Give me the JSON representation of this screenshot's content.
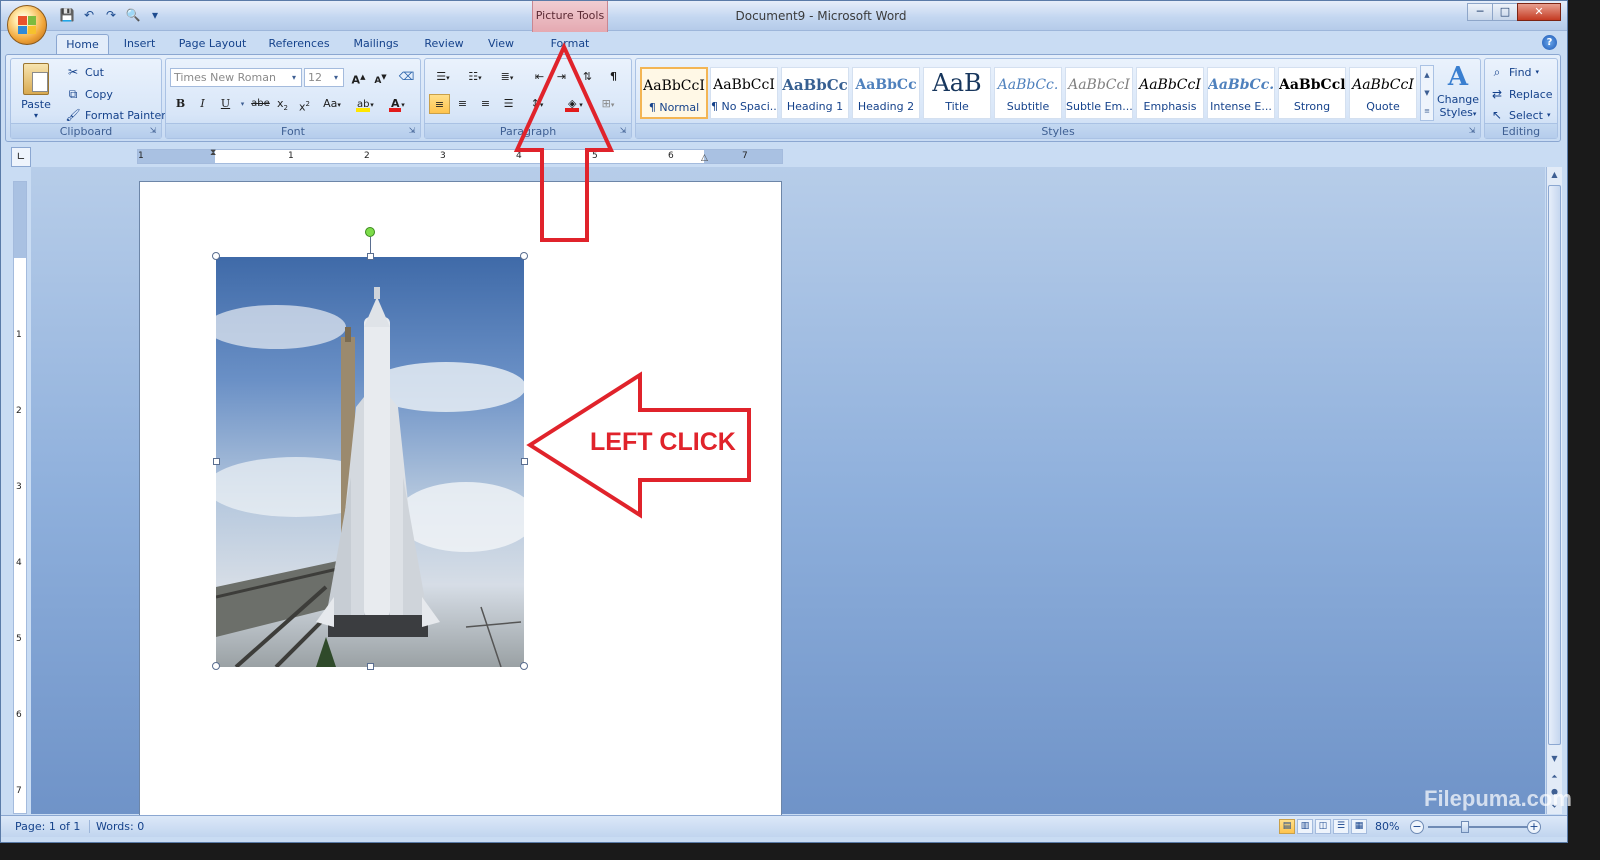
{
  "window": {
    "title": "Document9 - Microsoft Word",
    "context_tab_group": "Picture Tools"
  },
  "tabs": [
    "Home",
    "Insert",
    "Page Layout",
    "References",
    "Mailings",
    "Review",
    "View",
    "Format"
  ],
  "clipboard": {
    "paste": "Paste",
    "cut": "Cut",
    "copy": "Copy",
    "format_painter": "Format Painter",
    "label": "Clipboard"
  },
  "font": {
    "name_placeholder": "Times New Roman",
    "size_placeholder": "12",
    "label": "Font",
    "case_label": "Aa",
    "strike_label": "abe"
  },
  "paragraph": {
    "label": "Paragraph"
  },
  "styles": {
    "label": "Styles",
    "items": [
      {
        "sample": "AaBbCcI",
        "name": "¶ Normal"
      },
      {
        "sample": "AaBbCcI",
        "name": "¶ No Spaci..."
      },
      {
        "sample": "AaBbCc",
        "name": "Heading 1"
      },
      {
        "sample": "AaBbCc",
        "name": "Heading 2"
      },
      {
        "sample": "AaB",
        "name": "Title"
      },
      {
        "sample": "AaBbCc.",
        "name": "Subtitle"
      },
      {
        "sample": "AaBbCcI",
        "name": "Subtle Em..."
      },
      {
        "sample": "AaBbCcI",
        "name": "Emphasis"
      },
      {
        "sample": "AaBbCc.",
        "name": "Intense E..."
      },
      {
        "sample": "AaBbCcl",
        "name": "Strong"
      },
      {
        "sample": "AaBbCcI",
        "name": "Quote"
      }
    ],
    "change_styles_line1": "Change",
    "change_styles_line2": "Styles"
  },
  "editing": {
    "find": "Find",
    "replace": "Replace",
    "select": "Select",
    "label": "Editing"
  },
  "ruler": {
    "h_numbers": [
      "1",
      "1",
      "2",
      "3",
      "4",
      "5",
      "6",
      "7"
    ],
    "v_numbers": [
      "1",
      "2",
      "3",
      "4",
      "5",
      "6",
      "7"
    ]
  },
  "status": {
    "page": "Page: 1 of 1",
    "words": "Words: 0",
    "zoom": "80%"
  },
  "annotation": {
    "left_click": "LEFT CLICK"
  },
  "watermark": "Filepuma.com",
  "colors": {
    "annotation_red": "#e0232b",
    "highlight_yellow": "#ffe600",
    "font_red": "#e21b1b"
  }
}
